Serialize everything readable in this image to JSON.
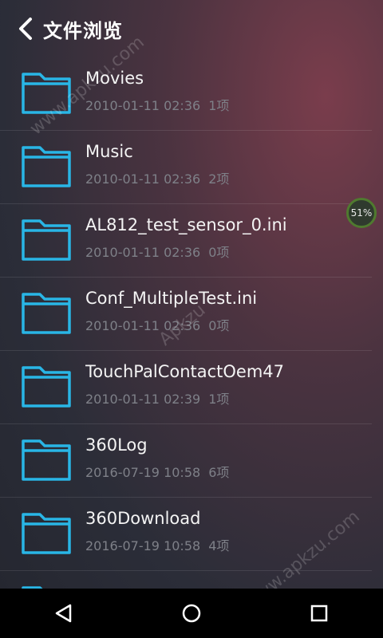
{
  "header": {
    "title": "文件浏览"
  },
  "files": [
    {
      "name": "Movies",
      "date": "2010-01-11 02:36",
      "count": "1项"
    },
    {
      "name": "Music",
      "date": "2010-01-11 02:36",
      "count": "2项"
    },
    {
      "name": "AL812_test_sensor_0.ini",
      "date": "2010-01-11 02:36",
      "count": "0项"
    },
    {
      "name": "Conf_MultipleTest.ini",
      "date": "2010-01-11 02:36",
      "count": "0项"
    },
    {
      "name": "TouchPalContactOem47",
      "date": "2010-01-11 02:39",
      "count": "1项"
    },
    {
      "name": "360Log",
      "date": "2016-07-19 10:58",
      "count": "6项"
    },
    {
      "name": "360Download",
      "date": "2016-07-19 10:58",
      "count": "4项"
    }
  ],
  "badge": {
    "percent": "51%"
  },
  "watermark": {
    "top": "www.apkzu.com",
    "middle": "Apkzu",
    "bottom": "www.apkzu.com"
  },
  "icons": {
    "back": "chevron-left-icon",
    "folder": "folder-icon",
    "nav_back": "triangle-back-icon",
    "nav_home": "circle-home-icon",
    "nav_recent": "square-recent-icon"
  },
  "colors": {
    "folder_outline": "#29b6e6",
    "nav_bg": "#000000",
    "badge_ring": "#4f7a2f"
  }
}
